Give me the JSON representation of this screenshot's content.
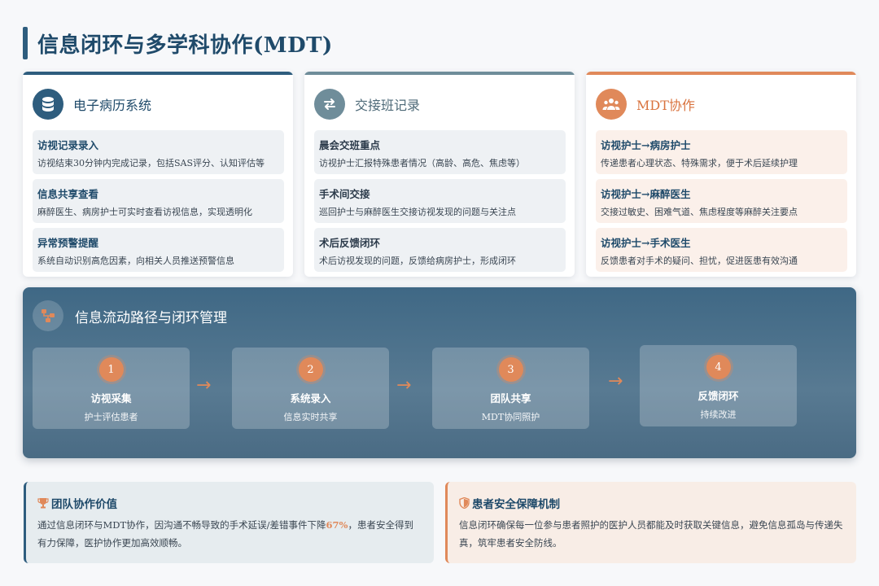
{
  "page": {
    "title": "信息闭环与多学科协作(MDT)"
  },
  "cards": [
    {
      "title": "电子病历系统",
      "icon": "database-icon",
      "items": [
        {
          "title": "访视记录录入",
          "desc": "访视结束30分钟内完成记录，包括SAS评分、认知评估等"
        },
        {
          "title": "信息共享查看",
          "desc": "麻醉医生、病房护士可实时查看访视信息，实现透明化"
        },
        {
          "title": "异常预警提醒",
          "desc": "系统自动识别高危因素，向相关人员推送预警信息"
        }
      ]
    },
    {
      "title": "交接班记录",
      "icon": "exchange-icon",
      "items": [
        {
          "title": "晨会交班重点",
          "desc": "访视护士汇报特殊患者情况（高龄、高危、焦虑等）"
        },
        {
          "title": "手术间交接",
          "desc": "巡回护士与麻醉医生交接访视发现的问题与关注点"
        },
        {
          "title": "术后反馈闭环",
          "desc": "术后访视发现的问题，反馈给病房护士，形成闭环"
        }
      ]
    },
    {
      "title": "MDT协作",
      "icon": "team-icon",
      "items": [
        {
          "title": "访视护士→病房护士",
          "desc": "传递患者心理状态、特殊需求，便于术后延续护理"
        },
        {
          "title": "访视护士→麻醉医生",
          "desc": "交接过敏史、困难气道、焦虑程度等麻醉关注要点"
        },
        {
          "title": "访视护士→手术医生",
          "desc": "反馈患者对手术的疑问、担忧，促进医患有效沟通"
        }
      ]
    }
  ],
  "flow": {
    "title": "信息流动路径与闭环管理",
    "steps": [
      {
        "num": "1",
        "title": "访视采集",
        "sub": "护士评估患者"
      },
      {
        "num": "2",
        "title": "系统录入",
        "sub": "信息实时共享"
      },
      {
        "num": "3",
        "title": "团队共享",
        "sub": "MDT协同照护"
      },
      {
        "num": "4",
        "title": "反馈闭环",
        "sub": "持续改进"
      }
    ]
  },
  "bottom": {
    "team_value": {
      "title": "团队协作价值",
      "text_before": "通过信息闭环与MDT协作，因沟通不畅导致的手术延误/差错事件下降",
      "highlight": "67%",
      "text_after": "，患者安全得到有力保障，医护协作更加高效顺畅。"
    },
    "safety": {
      "title": "患者安全保障机制",
      "text": "信息闭环确保每一位参与患者照护的医护人员都能及时获取关键信息，避免信息孤岛与传递失真，筑牢患者安全防线。"
    }
  },
  "colors": {
    "primary": "#2e5d7e",
    "secondary": "#6f8d9a",
    "accent": "#e0895a"
  }
}
